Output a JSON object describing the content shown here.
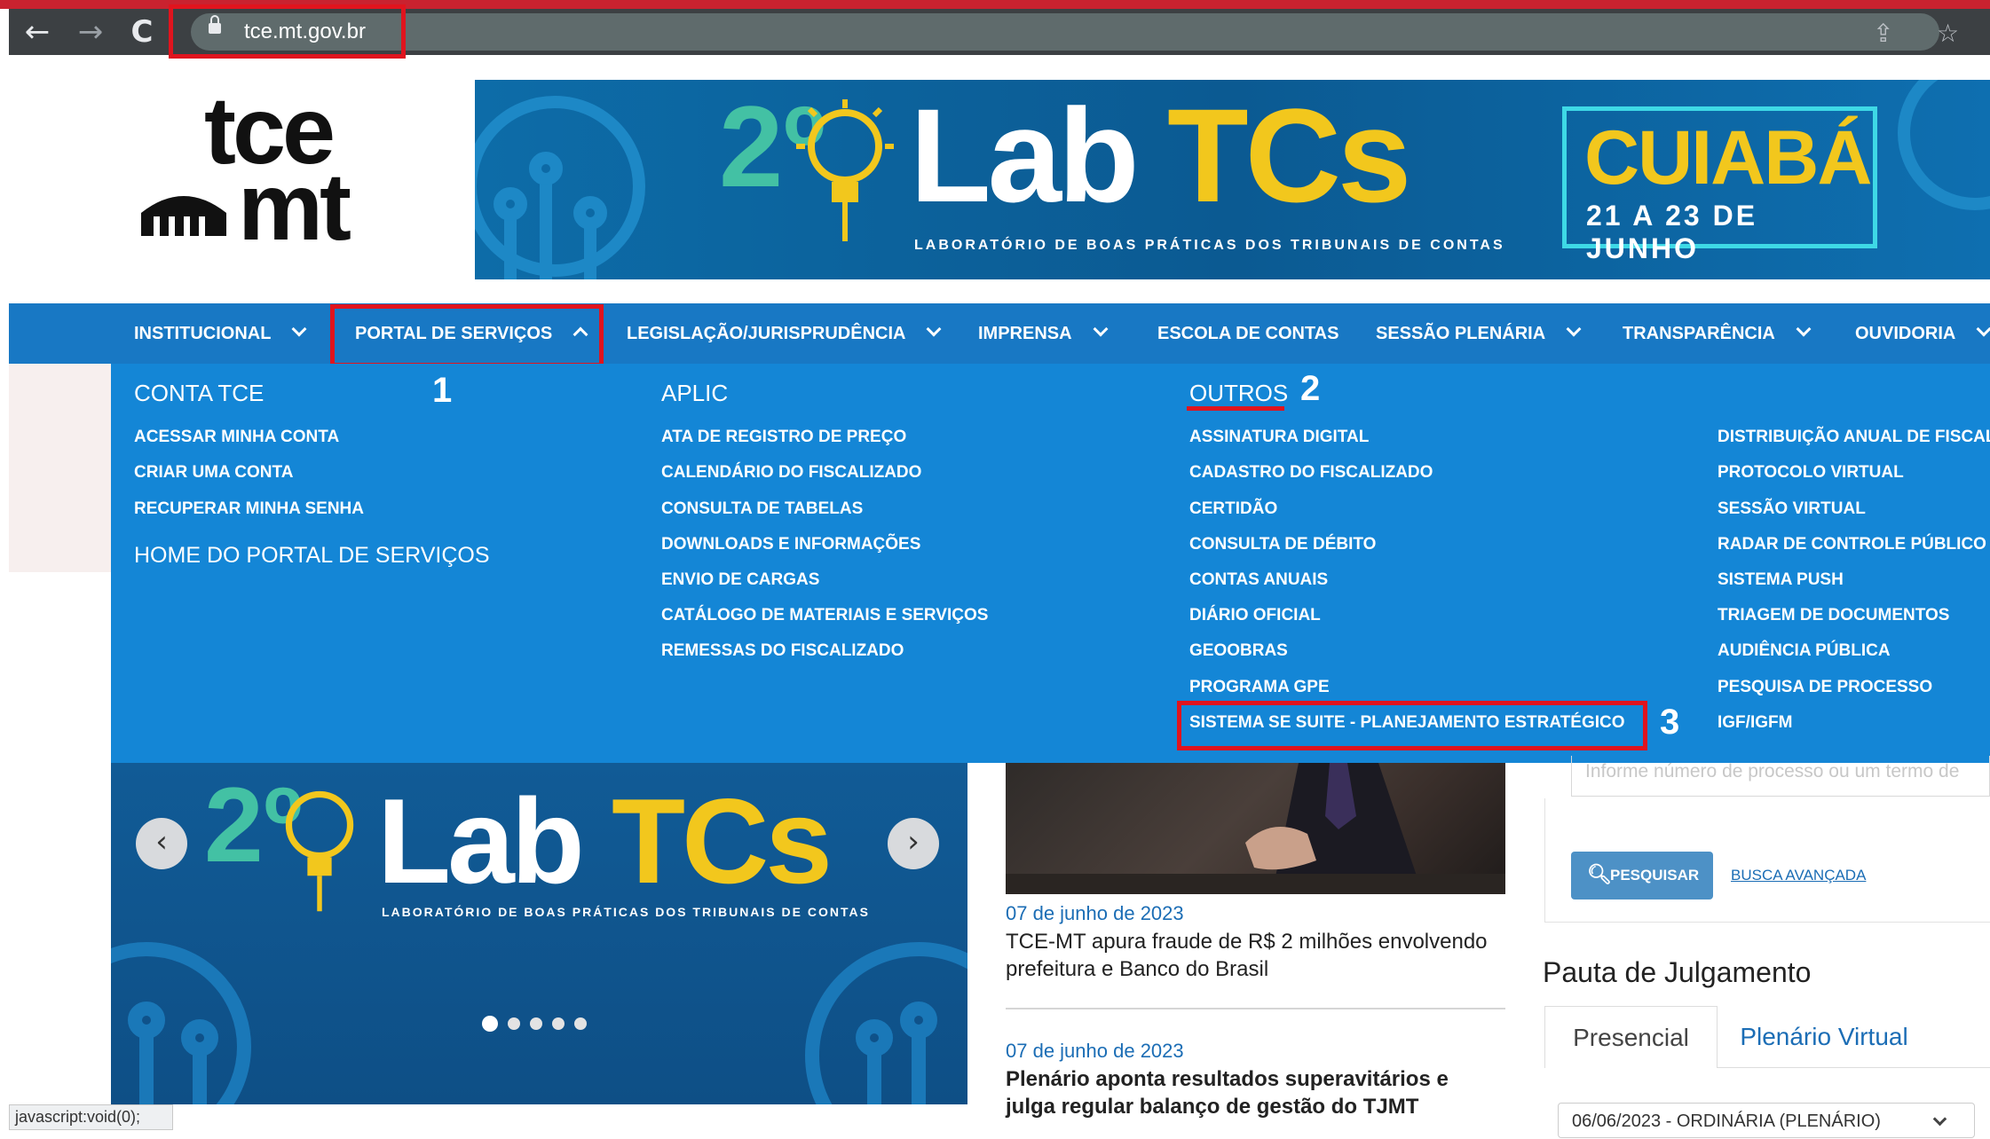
{
  "browser": {
    "url": "tce.mt.gov.br",
    "back_icon": "←",
    "forward_icon": "→",
    "reload_icon": "C",
    "share_icon": "⇪",
    "star_icon": "☆"
  },
  "logo": {
    "line1": "tce",
    "line2": "mt"
  },
  "banner": {
    "edition": "2º",
    "title_part1": "Lab",
    "title_part2": "TCs",
    "subtitle": "LABORATÓRIO DE BOAS PRÁTICAS DOS TRIBUNAIS DE CONTAS",
    "city": "CUIABÁ",
    "dates": "21 A 23 DE JUNHO"
  },
  "nav": {
    "items": [
      {
        "label": "INSTITUCIONAL"
      },
      {
        "label": "PORTAL DE SERVIÇOS"
      },
      {
        "label": "LEGISLAÇÃO/JURISPRUDÊNCIA"
      },
      {
        "label": "IMPRENSA"
      },
      {
        "label": "ESCOLA DE CONTAS"
      },
      {
        "label": "SESSÃO PLENÁRIA"
      },
      {
        "label": "TRANSPARÊNCIA"
      },
      {
        "label": "OUVIDORIA"
      }
    ]
  },
  "menu": {
    "conta": {
      "heading": "CONTA TCE",
      "items": [
        "ACESSAR MINHA CONTA",
        "CRIAR UMA CONTA",
        "RECUPERAR MINHA SENHA"
      ],
      "home": "HOME DO PORTAL DE SERVIÇOS"
    },
    "aplic": {
      "heading": "APLIC",
      "items": [
        "ATA DE REGISTRO DE PREÇO",
        "CALENDÁRIO DO FISCALIZADO",
        "CONSULTA DE TABELAS",
        "DOWNLOADS E INFORMAÇÕES",
        "ENVIO DE CARGAS",
        "CATÁLOGO DE MATERIAIS E SERVIÇOS",
        "REMESSAS DO FISCALIZADO"
      ]
    },
    "outros": {
      "heading": "OUTROS",
      "items": [
        "ASSINATURA DIGITAL",
        "CADASTRO DO FISCALIZADO",
        "CERTIDÃO",
        "CONSULTA DE DÉBITO",
        "CONTAS ANUAIS",
        "DIÁRIO OFICIAL",
        "GEOOBRAS",
        "PROGRAMA GPE",
        "SISTEMA SE SUITE - PLANEJAMENTO ESTRATÉGICO"
      ]
    },
    "col4": {
      "items": [
        "DISTRIBUIÇÃO ANUAL DE FISCAL",
        "PROTOCOLO VIRTUAL",
        "SESSÃO VIRTUAL",
        "RADAR DE CONTROLE PÚBLICO",
        "SISTEMA PUSH",
        "TRIAGEM DE DOCUMENTOS",
        "AUDIÊNCIA PÚBLICA",
        "PESQUISA DE PROCESSO",
        "IGF/IGFM"
      ]
    }
  },
  "annotations": {
    "step1": "1",
    "step2": "2",
    "step3": "3"
  },
  "carousel": {
    "edition": "2º",
    "title_part1": "Lab",
    "title_part2": "TCs",
    "subtitle": "LABORATÓRIO DE BOAS PRÁTICAS DOS TRIBUNAIS DE CONTAS",
    "prev_icon": "‹",
    "next_icon": "›"
  },
  "news": [
    {
      "date": "07 de junho de 2023",
      "title": "TCE-MT apura fraude de R$ 2 milhões envolvendo prefeitura e Banco do Brasil"
    },
    {
      "date": "07 de junho de 2023",
      "title": "Plenário aponta resultados superavitários e julga regular balanço de gestão do TJMT"
    }
  ],
  "search": {
    "placeholder": "Informe número de processo ou um termo de",
    "button": "PESQUISAR",
    "advanced": "BUSCA AVANÇADA"
  },
  "pauta": {
    "title": "Pauta de Julgamento",
    "tabs": [
      "Presencial",
      "Plenário Virtual"
    ],
    "session": "06/06/2023 - ORDINÁRIA (PLENÁRIO)"
  },
  "status_bar": "javascript:void(0);",
  "colors": {
    "nav": "#1878c4",
    "menu": "#1486d6",
    "highlight": "#e0141e",
    "accent_yellow": "#f2c71d",
    "accent_teal": "#43c1a4"
  }
}
